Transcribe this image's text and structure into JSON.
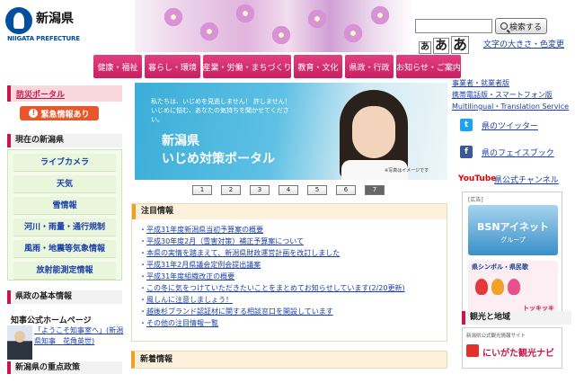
{
  "header": {
    "logo_jp": "新潟県",
    "logo_en": "NIIGATA PREFECTURE",
    "search": {
      "placeholder": "",
      "button_label": "検索する"
    },
    "font_size_buttons": [
      "あ",
      "あ",
      "あ"
    ],
    "font_color_link": "文字の大きさ・色変更"
  },
  "global_nav": [
    "健康・福祉",
    "暮らし・環境",
    "産業・労働・まちづくり",
    "教育・文化",
    "県政・行政",
    "お知らせ・ご案内"
  ],
  "left": {
    "bousai_label": "防災ポータル",
    "emergency_label": "緊急情報あり",
    "current_head": "現在の新潟県",
    "current_items": [
      "ライブカメラ",
      "天気",
      "雪情報",
      "河川・雨量・通行規制",
      "風雨・地震等気象情報",
      "放射能測定情報"
    ],
    "basic_head": "県政の基本情報",
    "governor_head": "知事公式ホームページ",
    "governor_text": "「ようこそ知事室へ」(新潟県知事　花角英世)",
    "focus_head": "新潟県の重点政策"
  },
  "banner": {
    "message": "私たちは、いじめを見逃しません！ 許しません！ いじめに悩む、あなたの気持ちを聞かせてください。",
    "title_line1": "新潟県",
    "title_line2": "いじめ対策ポータル",
    "note": "※写真はイメージです"
  },
  "pager": {
    "pages": [
      "1",
      "2",
      "3",
      "4",
      "5",
      "6",
      "7"
    ],
    "active": "7"
  },
  "notice": {
    "head": "注目情報",
    "items": [
      "平成31年度新潟県当初予算案の概要",
      "平成30年度2月（雪害対策）補正予算案について",
      "本県の実情を踏まえて、新潟県財政運営計画を改訂しました",
      "平成31年2月県議会定例会提出議案",
      "平成31年度組織改正の概要",
      "この冬に気をつけていただきたいことをまとめてお知らせしています(2/20更新)",
      "風しんに注意しましょう！",
      "越後杉ブランド認証材に関する相談窓口を開設しています",
      "その他の注目情報一覧"
    ]
  },
  "new_info_head": "新着情報",
  "right": {
    "links": [
      "事業者・就業者版",
      "携帯電話版・スマートフォン版",
      "Multilingual・Translation Service"
    ],
    "twitter": "県のツイッター",
    "facebook": "県のフェイスブック",
    "youtube_logo": "YouTube",
    "youtube": "県公式チャンネル",
    "ad_label": "[広告]",
    "bsn_title": "BSNアイネット",
    "bsn_sub": "グループ",
    "symbol_title": "県シンボル・県民歌",
    "tokki": "トッキッキ",
    "kanko_head": "観光と地域",
    "kanko_small": "新潟県公式観光情報サイト",
    "kanko_name": "にいがた観光ナビ"
  },
  "colors": {
    "accent": "#c8174c",
    "nav": "#d62a6c",
    "link": "#1a3fa8",
    "green_box": "#f3faea"
  }
}
